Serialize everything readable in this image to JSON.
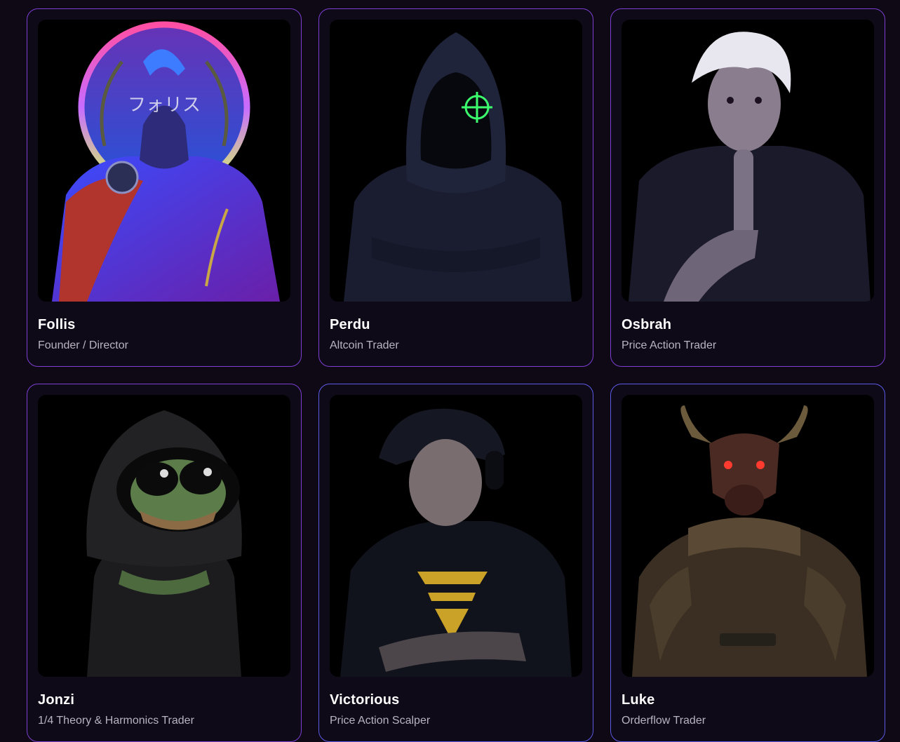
{
  "team": [
    {
      "name": "Follis",
      "role": "Founder / Director",
      "avatar": "laurel-warrior-avatar",
      "overlay_text": "フォリス"
    },
    {
      "name": "Perdu",
      "role": "Altcoin Trader",
      "avatar": "hooded-crosshair-avatar"
    },
    {
      "name": "Osbrah",
      "role": "Price Action Trader",
      "avatar": "white-hair-shush-avatar"
    },
    {
      "name": "Jonzi",
      "role": "1/4 Theory & Harmonics Trader",
      "avatar": "hooded-frog-avatar"
    },
    {
      "name": "Victorious",
      "role": "Price Action Scalper",
      "avatar": "headphones-hoodie-avatar"
    },
    {
      "name": "Luke",
      "role": "Orderflow Trader",
      "avatar": "armored-bull-avatar"
    }
  ],
  "colors": {
    "background": "#0e0915",
    "card_border_purple": "#7c3fd1",
    "card_border_blue": "#5b5be6",
    "name_text": "#ffffff",
    "role_text": "#b9b3c3"
  }
}
